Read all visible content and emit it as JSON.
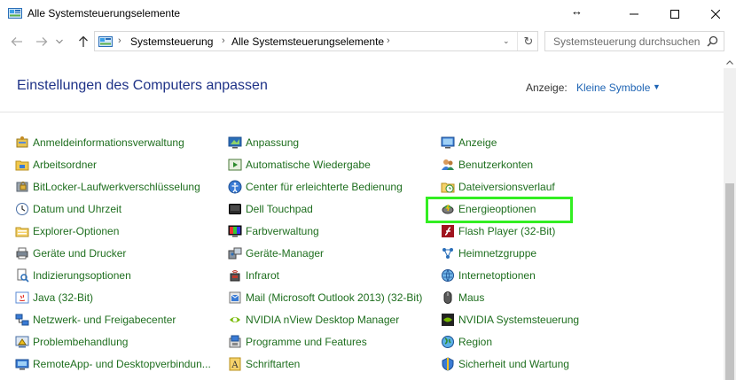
{
  "window": {
    "title": "Alle Systemsteuerungselemente",
    "resize_glyph": "↔",
    "controls": [
      "minimize-icon",
      "maximize-icon",
      "close-icon"
    ]
  },
  "navigation": {
    "back_icon": "back-arrow-icon",
    "forward_icon": "forward-arrow-icon",
    "recent_icon": "chevron-down-icon",
    "up_icon": "up-arrow-icon"
  },
  "address": {
    "crumbs": [
      "Systemsteuerung",
      "Alle Systemsteuerungselemente"
    ],
    "separator": "›",
    "dropdown_glyph": "⌄",
    "refresh_glyph": "↻"
  },
  "search": {
    "placeholder": "Systemsteuerung durchsuchen"
  },
  "header": {
    "title": "Einstellungen des Computers anpassen",
    "view_label": "Anzeige:",
    "view_value": "Kleine Symbole",
    "view_caret": "▼"
  },
  "colors": {
    "link": "#1e6e1e",
    "heading": "#1e3287",
    "view_link": "#1e64b4",
    "highlight": "#33ee22"
  },
  "items": {
    "col1": [
      {
        "label": "Anmeldeinformationsverwaltung",
        "icon": "credential-manager-icon"
      },
      {
        "label": "Arbeitsordner",
        "icon": "work-folders-icon"
      },
      {
        "label": "BitLocker-Laufwerkverschlüsselung",
        "icon": "bitlocker-icon"
      },
      {
        "label": "Datum und Uhrzeit",
        "icon": "clock-icon"
      },
      {
        "label": "Explorer-Optionen",
        "icon": "folder-options-icon"
      },
      {
        "label": "Geräte und Drucker",
        "icon": "printer-icon"
      },
      {
        "label": "Indizierungsoptionen",
        "icon": "indexing-icon"
      },
      {
        "label": "Java (32-Bit)",
        "icon": "java-icon"
      },
      {
        "label": "Netzwerk- und Freigabecenter",
        "icon": "network-icon"
      },
      {
        "label": "Problembehandlung",
        "icon": "troubleshooting-icon"
      },
      {
        "label": "RemoteApp- und Desktopverbindun...",
        "icon": "remoteapp-icon"
      }
    ],
    "col2": [
      {
        "label": "Anpassung",
        "icon": "personalization-icon"
      },
      {
        "label": "Automatische Wiedergabe",
        "icon": "autoplay-icon"
      },
      {
        "label": "Center für erleichterte Bedienung",
        "icon": "ease-of-access-icon"
      },
      {
        "label": "Dell Touchpad",
        "icon": "touchpad-icon"
      },
      {
        "label": "Farbverwaltung",
        "icon": "color-management-icon"
      },
      {
        "label": "Geräte-Manager",
        "icon": "device-manager-icon"
      },
      {
        "label": "Infrarot",
        "icon": "infrared-icon"
      },
      {
        "label": "Mail (Microsoft Outlook 2013) (32-Bit)",
        "icon": "mail-icon"
      },
      {
        "label": "NVIDIA nView Desktop Manager",
        "icon": "nvidia-icon"
      },
      {
        "label": "Programme und Features",
        "icon": "programs-icon"
      },
      {
        "label": "Schriftarten",
        "icon": "fonts-icon"
      }
    ],
    "col3": [
      {
        "label": "Anzeige",
        "icon": "display-icon"
      },
      {
        "label": "Benutzerkonten",
        "icon": "user-accounts-icon"
      },
      {
        "label": "Dateiversionsverlauf",
        "icon": "file-history-icon"
      },
      {
        "label": "Energieoptionen",
        "icon": "power-options-icon"
      },
      {
        "label": "Flash Player (32-Bit)",
        "icon": "flash-icon"
      },
      {
        "label": "Heimnetzgruppe",
        "icon": "homegroup-icon"
      },
      {
        "label": "Internetoptionen",
        "icon": "internet-options-icon"
      },
      {
        "label": "Maus",
        "icon": "mouse-icon"
      },
      {
        "label": "NVIDIA Systemsteuerung",
        "icon": "nvidia-control-icon"
      },
      {
        "label": "Region",
        "icon": "region-icon"
      },
      {
        "label": "Sicherheit und Wartung",
        "icon": "security-maintenance-icon"
      }
    ]
  }
}
